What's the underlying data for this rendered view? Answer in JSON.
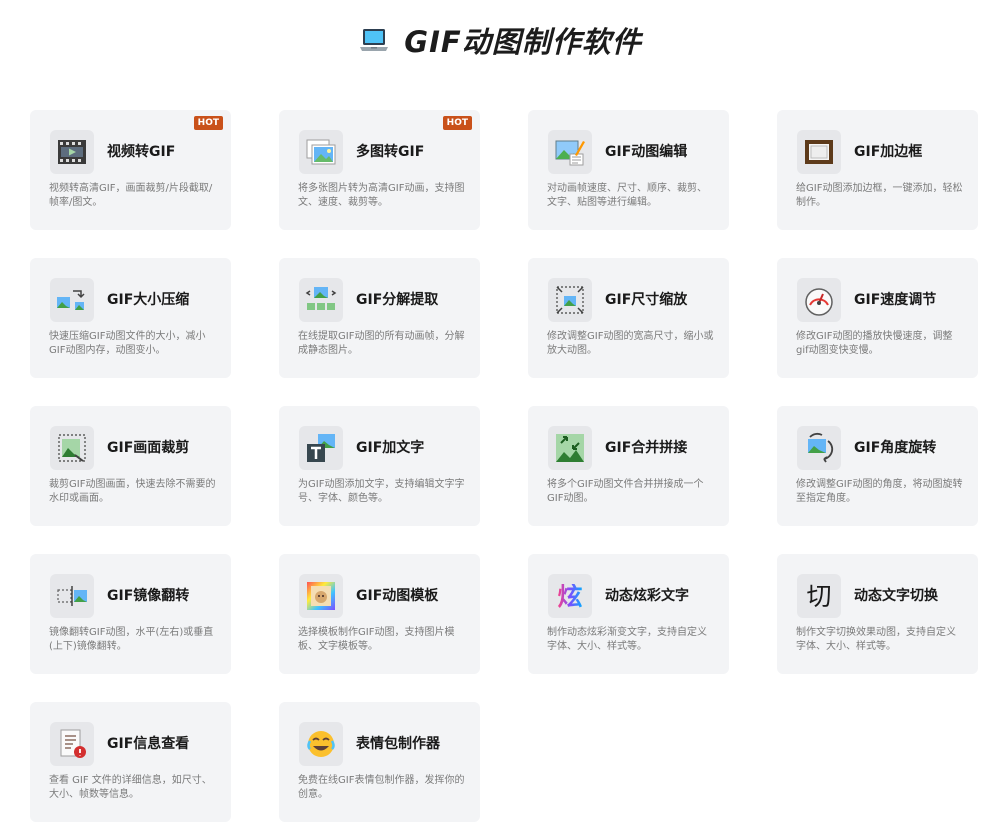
{
  "header": {
    "title": "GIF动图制作软件",
    "icon": "laptop-icon"
  },
  "hot_label": "HOT",
  "tools": [
    {
      "title": "视频转GIF",
      "desc": "视频转高清GIF，画面裁剪/片段截取/帧率/图文。",
      "icon": "film-icon",
      "hot": true
    },
    {
      "title": "多图转GIF",
      "desc": "将多张图片转为高清GIF动画，支持图文、速度、裁剪等。",
      "icon": "images-icon",
      "hot": true
    },
    {
      "title": "GIF动图编辑",
      "desc": "对动画帧速度、尺寸、顺序、裁剪、文字、贴图等进行编辑。",
      "icon": "edit-image-icon",
      "hot": false
    },
    {
      "title": "GIF加边框",
      "desc": "给GIF动图添加边框，一键添加，轻松制作。",
      "icon": "frame-icon",
      "hot": false
    },
    {
      "title": "GIF大小压缩",
      "desc": "快速压缩GIF动图文件的大小，减小GIF动图内存，动图变小。",
      "icon": "compress-icon",
      "hot": false
    },
    {
      "title": "GIF分解提取",
      "desc": "在线提取GIF动图的所有动画帧，分解成静态图片。",
      "icon": "split-icon",
      "hot": false
    },
    {
      "title": "GIF尺寸缩放",
      "desc": "修改调整GIF动图的宽高尺寸，缩小或放大动图。",
      "icon": "resize-icon",
      "hot": false
    },
    {
      "title": "GIF速度调节",
      "desc": "修改GIF动图的播放快慢速度，调整gif动图变快变慢。",
      "icon": "speedometer-icon",
      "hot": false
    },
    {
      "title": "GIF画面裁剪",
      "desc": "裁剪GIF动图画面，快速去除不需要的水印或画面。",
      "icon": "crop-icon",
      "hot": false
    },
    {
      "title": "GIF加文字",
      "desc": "为GIF动图添加文字，支持编辑文字字号、字体、颜色等。",
      "icon": "text-icon",
      "hot": false
    },
    {
      "title": "GIF合并拼接",
      "desc": "将多个GIF动图文件合并拼接成一个GIF动图。",
      "icon": "merge-icon",
      "hot": false
    },
    {
      "title": "GIF角度旋转",
      "desc": "修改调整GIF动图的角度，将动图旋转至指定角度。",
      "icon": "rotate-icon",
      "hot": false
    },
    {
      "title": "GIF镜像翻转",
      "desc": "镜像翻转GIF动图，水平(左右)或垂直(上下)镜像翻转。",
      "icon": "mirror-icon",
      "hot": false
    },
    {
      "title": "GIF动图模板",
      "desc": "选择模板制作GIF动图，支持图片模板、文字模板等。",
      "icon": "template-icon",
      "hot": false
    },
    {
      "title": "动态炫彩文字",
      "desc": "制作动态炫彩渐变文字，支持自定义字体、大小、样式等。",
      "icon": "colorful-text-icon",
      "glyph": "炫",
      "hot": false
    },
    {
      "title": "动态文字切换",
      "desc": "制作文字切换效果动图，支持自定义字体、大小、样式等。",
      "icon": "switch-text-icon",
      "glyph": "切",
      "hot": false
    },
    {
      "title": "GIF信息查看",
      "desc": "查看 GIF 文件的详细信息，如尺寸、大小、帧数等信息。",
      "icon": "info-doc-icon",
      "hot": false
    },
    {
      "title": "表情包制作器",
      "desc": "免费在线GIF表情包制作器，发挥你的创意。",
      "icon": "emoji-icon",
      "hot": false
    }
  ]
}
